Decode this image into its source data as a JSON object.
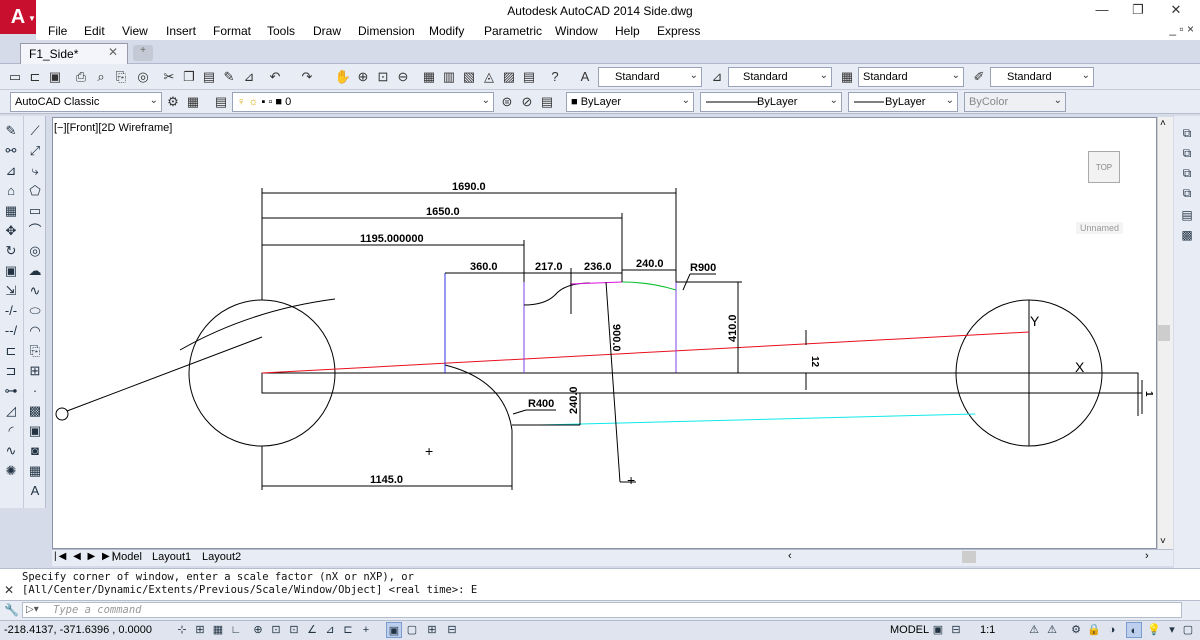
{
  "window": {
    "title": "Autodesk AutoCAD 2014   Side.dwg",
    "logo": "A",
    "minimize": "—",
    "maximize": "❐",
    "close": "✕"
  },
  "menu": {
    "items": [
      "File",
      "Edit",
      "View",
      "Insert",
      "Format",
      "Tools",
      "Draw",
      "Dimension",
      "Modify",
      "Parametric",
      "Window",
      "Help",
      "Express"
    ],
    "doc_controls": "_ ▫ ×"
  },
  "tabs": {
    "document": "F1_Side*",
    "close": "✕",
    "new_tab": "+"
  },
  "toolbar1": {
    "text_style": "Standard",
    "dim_style": "Standard",
    "table_style": "Standard",
    "mleader_style": "Standard"
  },
  "toolbar2": {
    "workspace": "AutoCAD Classic",
    "layer": "0",
    "color": "ByLayer",
    "linetype": "ByLayer",
    "lineweight": "ByLayer",
    "plotstyle": "ByColor"
  },
  "viewport": {
    "label": "[−][Front][2D Wireframe]",
    "viewcube": "TOP",
    "ucs": "Unnamed"
  },
  "drawing": {
    "dims": {
      "d1690": "1690.0",
      "d1650": "1650.0",
      "d1195": "1195.000000",
      "d360": "360.0",
      "d217": "217.0",
      "d236": "236.0",
      "d240top": "240.0",
      "r900": "R900",
      "d410": "410.0",
      "d900v": "900.0",
      "d240v": "240.0",
      "r400": "R400",
      "d1145": "1145.0",
      "d12": "12",
      "d1": "1",
      "y_axis": "Y",
      "x_mark": "X"
    },
    "colors": {
      "red_line": "#e8101e",
      "cyan_line": "#10e8e8",
      "blue_line": "#3030e0",
      "purple_line": "#8040e0",
      "magenta_line": "#e010e0",
      "green_line": "#10c030"
    }
  },
  "layout_tabs": {
    "model": "Model",
    "layout1": "Layout1",
    "layout2": "Layout2"
  },
  "command": {
    "line1": "Specify corner of window, enter a scale factor (nX or nXP), or",
    "line2": "[All/Center/Dynamic/Extents/Previous/Scale/Window/Object] <real time>: E",
    "placeholder": "Type a command"
  },
  "status": {
    "coords": "-218.4137, -371.6396 , 0.0000",
    "model": "MODEL",
    "scale": "1:1"
  }
}
